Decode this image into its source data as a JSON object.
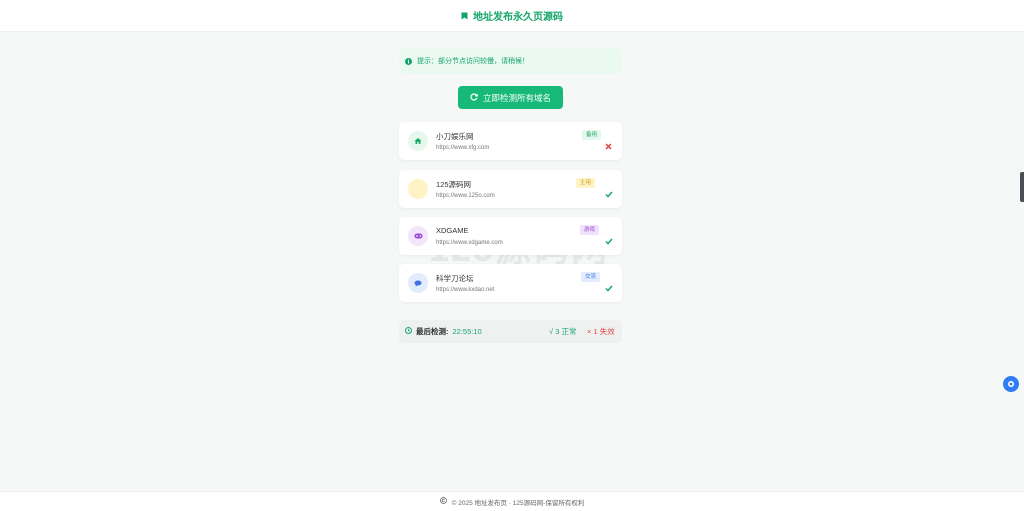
{
  "header": {
    "title": "地址发布永久页源码",
    "icon": "bookmark-icon"
  },
  "notice": {
    "text": "提示：部分节点访问较慢，请稍候！",
    "icon": "info-icon"
  },
  "check_button": {
    "label": "立即检测所有域名",
    "icon": "refresh-icon"
  },
  "sites": [
    {
      "name": "小刀娱乐网",
      "url": "https://www.xfg.com",
      "badge": "备用",
      "status": "fail",
      "icon": "home-icon",
      "avatar_color": "#e6f8ee",
      "badge_bg": "#e4f7ec",
      "badge_fg": "#1aa865"
    },
    {
      "name": "125源码网",
      "url": "https://www.125o.com",
      "badge": "主用",
      "status": "ok",
      "icon": "code-icon",
      "avatar_color": "#fdf3c4",
      "badge_bg": "#fdf3c4",
      "badge_fg": "#d39a12"
    },
    {
      "name": "XDGAME",
      "url": "https://www.xdgame.com",
      "badge": "游戏",
      "status": "ok",
      "icon": "gamepad-icon",
      "avatar_color": "#f3e6fb",
      "badge_bg": "#f1e2fb",
      "badge_fg": "#9b4ad8"
    },
    {
      "name": "科学刀论坛",
      "url": "https://www.kxdao.net",
      "badge": "交流",
      "status": "ok",
      "icon": "chat-icon",
      "avatar_color": "#e3ecfd",
      "badge_bg": "#e3ecfd",
      "badge_fg": "#3b73e0"
    }
  ],
  "summary": {
    "label": "最后检测:",
    "time": "22:55:10",
    "ok_text": "√ 3 正常",
    "fail_text": "× 1 失效"
  },
  "watermark": {
    "line1": "125源码网",
    "line2": "www.125o.com"
  },
  "footer": {
    "text": "© 2025 地址发布页 · 125源码网-保留所有权利"
  },
  "colors": {
    "accent": "#17b978",
    "ok": "#17a870",
    "fail": "#e04848"
  }
}
